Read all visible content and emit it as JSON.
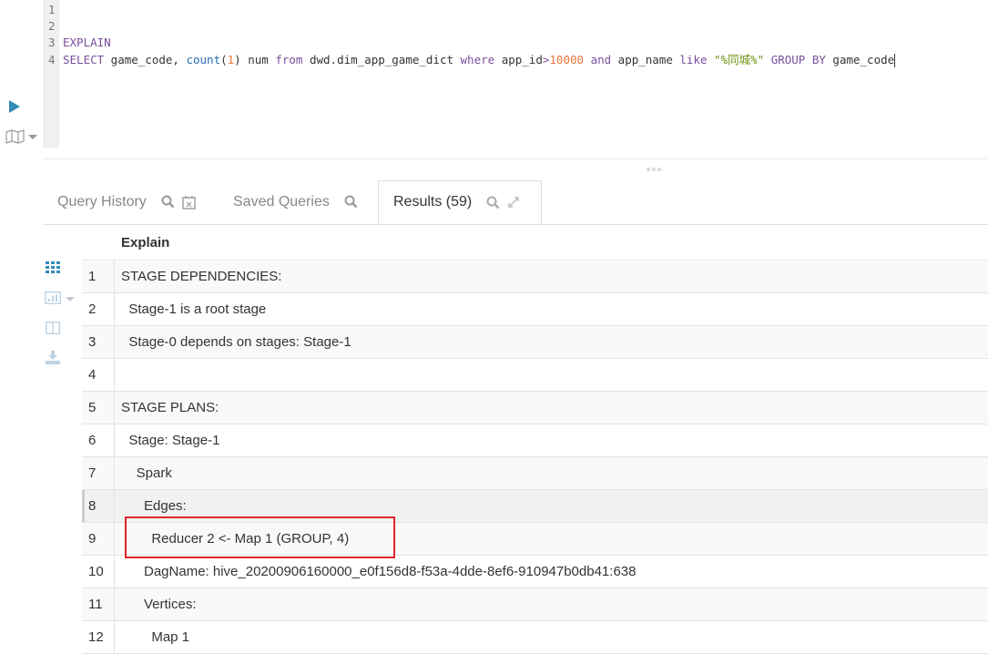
{
  "editor": {
    "lines": [
      {
        "num": "1",
        "tokens": []
      },
      {
        "num": "2",
        "tokens": []
      },
      {
        "num": "3",
        "tokens": [
          {
            "t": "kw",
            "v": "EXPLAIN"
          }
        ]
      },
      {
        "num": "4",
        "tokens": [
          {
            "t": "kw",
            "v": "SELECT"
          },
          {
            "t": "",
            "v": " game_code, "
          },
          {
            "t": "fn",
            "v": "count"
          },
          {
            "t": "",
            "v": "("
          },
          {
            "t": "num",
            "v": "1"
          },
          {
            "t": "",
            "v": ") num "
          },
          {
            "t": "kw",
            "v": "from"
          },
          {
            "t": "",
            "v": " dwd.dim_app_game_dict "
          },
          {
            "t": "kw",
            "v": "where"
          },
          {
            "t": "",
            "v": " app_id"
          },
          {
            "t": "kw",
            "v": ">"
          },
          {
            "t": "num",
            "v": "10000"
          },
          {
            "t": "",
            "v": " "
          },
          {
            "t": "kw",
            "v": "and"
          },
          {
            "t": "",
            "v": " app_name "
          },
          {
            "t": "kw",
            "v": "like"
          },
          {
            "t": "",
            "v": " "
          },
          {
            "t": "str",
            "v": "\"%同城%\""
          },
          {
            "t": "",
            "v": " "
          },
          {
            "t": "kw",
            "v": "GROUP BY"
          },
          {
            "t": "",
            "v": " game_code"
          }
        ]
      }
    ]
  },
  "actions": {
    "run_icon": "play-icon",
    "snippets_icon": "map-icon"
  },
  "tabs": [
    {
      "label": "Query History",
      "icons": [
        "search-icon",
        "calendar-x-icon"
      ],
      "active": false
    },
    {
      "label": "Saved Queries",
      "icons": [
        "search-icon"
      ],
      "active": false
    },
    {
      "label": "Results (59)",
      "icons": [
        "search-icon",
        "expand-icon"
      ],
      "active": true
    }
  ],
  "results_tools": [
    "grid-icon",
    "chart-icon",
    "columns-icon",
    "download-icon"
  ],
  "table": {
    "header": "Explain",
    "rows": [
      {
        "n": "1",
        "v": "STAGE DEPENDENCIES:"
      },
      {
        "n": "2",
        "v": "  Stage-1 is a root stage"
      },
      {
        "n": "3",
        "v": "  Stage-0 depends on stages: Stage-1"
      },
      {
        "n": "4",
        "v": ""
      },
      {
        "n": "5",
        "v": "STAGE PLANS:"
      },
      {
        "n": "6",
        "v": "  Stage: Stage-1"
      },
      {
        "n": "7",
        "v": "    Spark"
      },
      {
        "n": "8",
        "v": "      Edges:"
      },
      {
        "n": "9",
        "v": "        Reducer 2 <- Map 1 (GROUP, 4)"
      },
      {
        "n": "10",
        "v": "      DagName: hive_20200906160000_e0f156d8-f53a-4dde-8ef6-910947b0db41:638"
      },
      {
        "n": "11",
        "v": "      Vertices:"
      },
      {
        "n": "12",
        "v": "        Map 1"
      }
    ],
    "hover_row": "8",
    "highlighted_row": "9"
  },
  "colors": {
    "accent": "#338bb8",
    "highlight_border": "#e0262a"
  }
}
